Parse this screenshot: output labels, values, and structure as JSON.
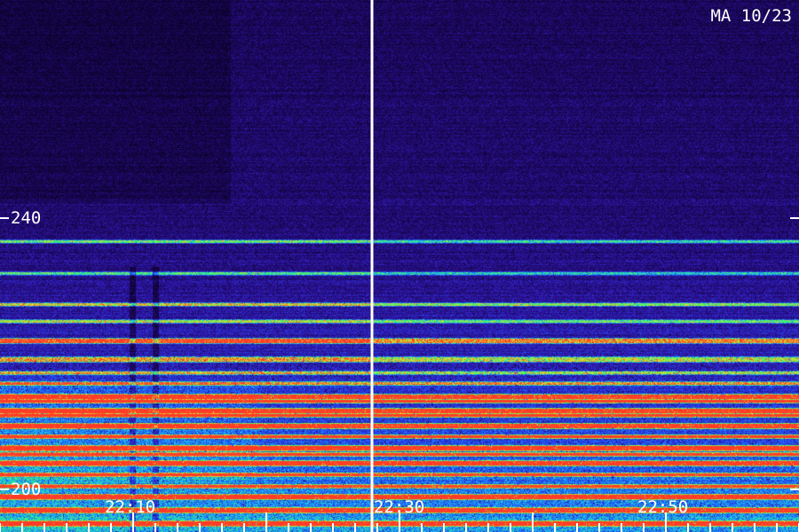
{
  "stamp": "MA 10/23",
  "freq_labels": [
    "240",
    "200"
  ],
  "time_labels": [
    "22:10",
    "22:30",
    "22:50"
  ],
  "colors": {
    "background": "#1a0850",
    "noise_low": "#2a0a78",
    "noise_mid": "#3a1ab0",
    "band_blue": "#2a6aff",
    "band_cyan": "#20d0e0",
    "band_green": "#40ff40",
    "band_yellow": "#e8e020",
    "band_red": "#ff4030",
    "text": "#ffffff"
  }
}
